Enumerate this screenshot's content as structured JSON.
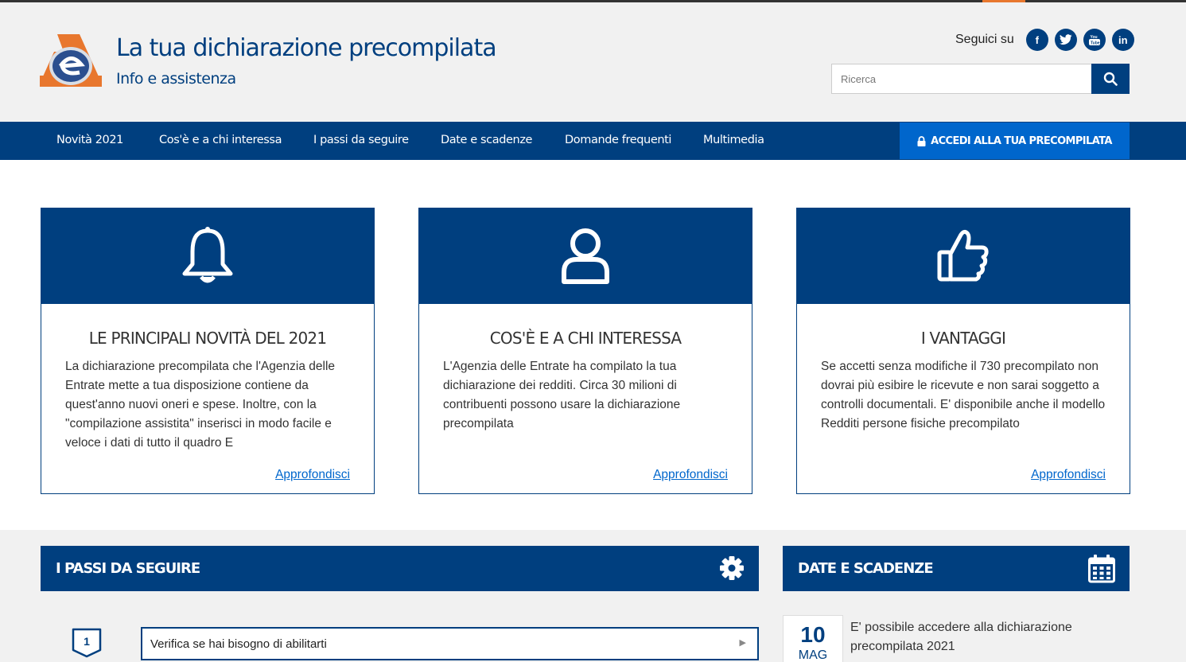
{
  "header": {
    "title": "La tua dichiarazione precompilata",
    "subtitle": "Info e assistenza",
    "social_label": "Seguici su",
    "social": [
      {
        "icon": "facebook-icon",
        "glyph": "f"
      },
      {
        "icon": "twitter-icon",
        "glyph": "t"
      },
      {
        "icon": "youtube-icon",
        "glyph": "▶"
      },
      {
        "icon": "linkedin-icon",
        "glyph": "in"
      }
    ],
    "search": {
      "placeholder": "Ricerca",
      "value": ""
    }
  },
  "nav": {
    "items": [
      "Novità 2021",
      "Cos'è e a chi interessa",
      "I passi da seguire",
      "Date e scadenze",
      "Domande frequenti",
      "Multimedia"
    ],
    "login_label": "ACCEDI ALLA TUA PRECOMPILATA"
  },
  "cards": [
    {
      "icon": "bell-icon",
      "title": "LE PRINCIPALI NOVITÀ DEL 2021",
      "text": "La dichiarazione precompilata che l'Agenzia delle Entrate mette a tua disposizione contiene da quest'anno nuovi oneri e spese. Inoltre, con la \"compilazione assistita\" inserisci in modo facile e veloce i dati di tutto il quadro E",
      "link": "Approfondisci"
    },
    {
      "icon": "user-icon",
      "title": "COS'È E A CHI INTERESSA",
      "text": "L'Agenzia delle Entrate ha compilato la tua dichiarazione dei redditi. Circa 30 milioni di contribuenti possono usare la dichiarazione precompilata",
      "link": "Approfondisci"
    },
    {
      "icon": "thumbs-up-icon",
      "title": "I VANTAGGI",
      "text": "Se accetti senza modifiche il 730 precompilato non dovrai più esibire le ricevute e non sarai soggetto a controlli documentali. E' disponibile anche il modello Redditi persone fisiche precompilato",
      "link": "Approfondisci"
    }
  ],
  "steps": {
    "title": "I PASSI DA SEGUIRE",
    "icon": "gear-icon",
    "items": [
      {
        "number": "1",
        "label": "Verifica se hai bisogno di abilitarti",
        "chevron": "▶"
      }
    ]
  },
  "dates": {
    "title": "DATE E SCADENZE",
    "icon": "calendar-icon",
    "items": [
      {
        "day": "10",
        "month": "MAG",
        "text": "E' possibile accedere alla dichiarazione precompilata 2021"
      }
    ]
  },
  "colors": {
    "primary": "#003f7f",
    "accent_blue": "#0066cc",
    "orange": "#e8772e",
    "background": "#f1f1f1"
  }
}
